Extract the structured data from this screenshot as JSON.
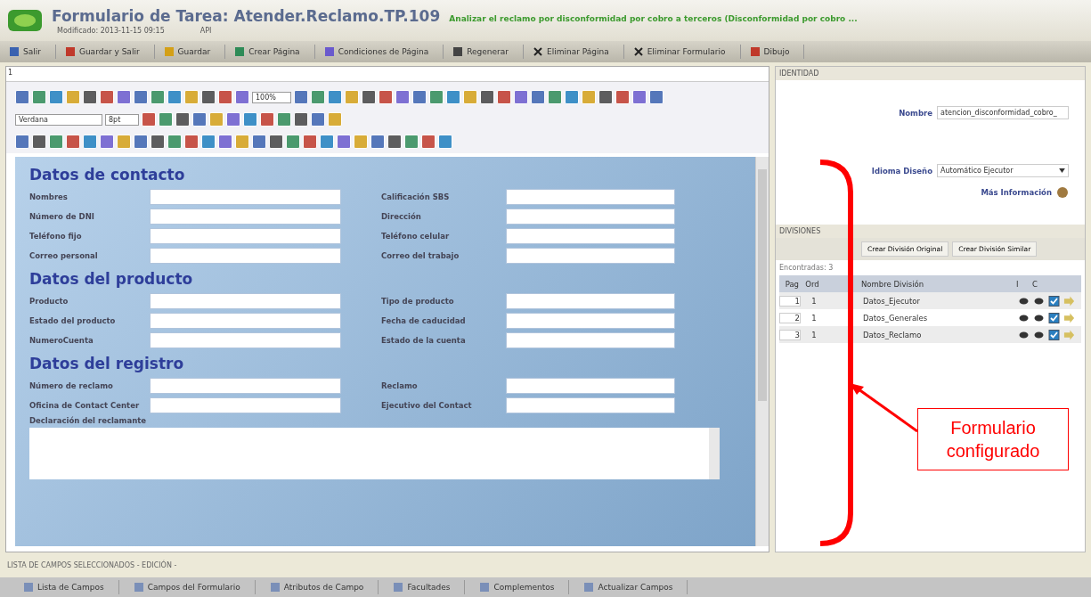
{
  "window": {
    "title": "Formulario de Tarea: Atender.Reclamo.TP.109",
    "description": "Analizar el reclamo por disconformidad por cobro a terceros (Disconformidad por cobro ...",
    "modified": "Modificado: 2013-11-15 09:15",
    "api": "API"
  },
  "toolbar": [
    "Salir",
    "Guardar y Salir",
    "Guardar",
    "Crear Página",
    "Condiciones de Página",
    "Regenerar",
    "Eliminar Página",
    "Eliminar Formulario",
    "Dibujo"
  ],
  "page_tab": "1",
  "editor": {
    "zoom": "100%",
    "font": "Verdana",
    "size": "8pt"
  },
  "form": {
    "sections": [
      {
        "title": "Datos de contacto",
        "fields": [
          [
            "Nombres",
            "Calificación SBS"
          ],
          [
            "Número de DNI",
            "Dirección"
          ],
          [
            "Teléfono fijo",
            "Teléfono celular"
          ],
          [
            "Correo personal",
            "Correo del trabajo"
          ]
        ]
      },
      {
        "title": "Datos del producto",
        "fields": [
          [
            "Producto",
            "Tipo de producto"
          ],
          [
            "Estado del producto",
            "Fecha de caducidad"
          ],
          [
            "NumeroCuenta",
            "Estado de la cuenta"
          ]
        ]
      },
      {
        "title": "Datos del registro",
        "fields": [
          [
            "Número de reclamo",
            "Reclamo"
          ],
          [
            "Oficina de Contact Center",
            "Ejecutivo del Contact"
          ]
        ],
        "textarea_label": "Declaración del reclamante"
      }
    ]
  },
  "identity": {
    "heading": "IDENTIDAD",
    "name_label": "Nombre",
    "name_value": "atencion_disconformidad_cobro_",
    "language_label": "Idioma Diseño",
    "language_value": "Automático Ejecutor",
    "more_info": "Más Información"
  },
  "divisions": {
    "heading": "DIVISIONES",
    "buttons": [
      "Crear División Original",
      "Crear División Similar"
    ],
    "found": "Encontradas: 3",
    "columns": [
      "Pag",
      "Ord",
      "Nombre División",
      "I",
      "C"
    ],
    "rows": [
      {
        "pag": "1",
        "ord": "1",
        "name": "Datos_Ejecutor",
        "checked": true
      },
      {
        "pag": "2",
        "ord": "1",
        "name": "Datos_Generales",
        "checked": true
      },
      {
        "pag": "3",
        "ord": "1",
        "name": "Datos_Reclamo",
        "checked": true
      }
    ]
  },
  "bottom": {
    "title": "LISTA DE CAMPOS SELECCIONADOS - EDICIÓN -",
    "buttons": [
      "Lista de Campos",
      "Campos del Formulario",
      "Atributos de Campo",
      "Facultades",
      "Complementos",
      "Actualizar Campos"
    ]
  },
  "annotation": {
    "text": "Formulario configurado"
  }
}
